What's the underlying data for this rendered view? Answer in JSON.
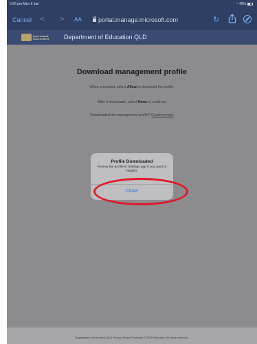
{
  "status_bar": {
    "time": "9:26 pm  Mon 6 Jan",
    "battery": "49%"
  },
  "toolbar": {
    "cancel_label": "Cancel",
    "back_glyph": "<",
    "forward_glyph": ">",
    "text_size_label": "AA",
    "url": "portal.manage.microsoft.com",
    "reload_icon": "reload-icon",
    "share_icon": "share-icon",
    "compass_icon": "compass-icon"
  },
  "site_header": {
    "logo_text": "Queensland Government",
    "title": "Department of Education QLD"
  },
  "main": {
    "title": "Download management profile",
    "instruction1_pre": "When prompted, select ",
    "instruction1_bold": "Allow",
    "instruction1_post": " to download the profile.",
    "instruction2_pre": "After it downloads, select ",
    "instruction2_bold": "Done",
    "instruction2_post": " to continue.",
    "instruction3_pre": "Downloaded the management profile? ",
    "instruction3_link": "Continue now."
  },
  "alert": {
    "title": "Profile Downloaded",
    "message": "Review the profile in Settings app if you want to install it.",
    "button": "Close"
  },
  "footer": {
    "text": "Department of Education QLD Privacy Terms   Feedback   © 2020 Microsoft. All rights reserved."
  },
  "colors": {
    "accent_link": "#2f6fcc",
    "highlight": "#e0162b",
    "header_bg": "#3a4a73",
    "overlay_bg": "#8c8c8e"
  }
}
